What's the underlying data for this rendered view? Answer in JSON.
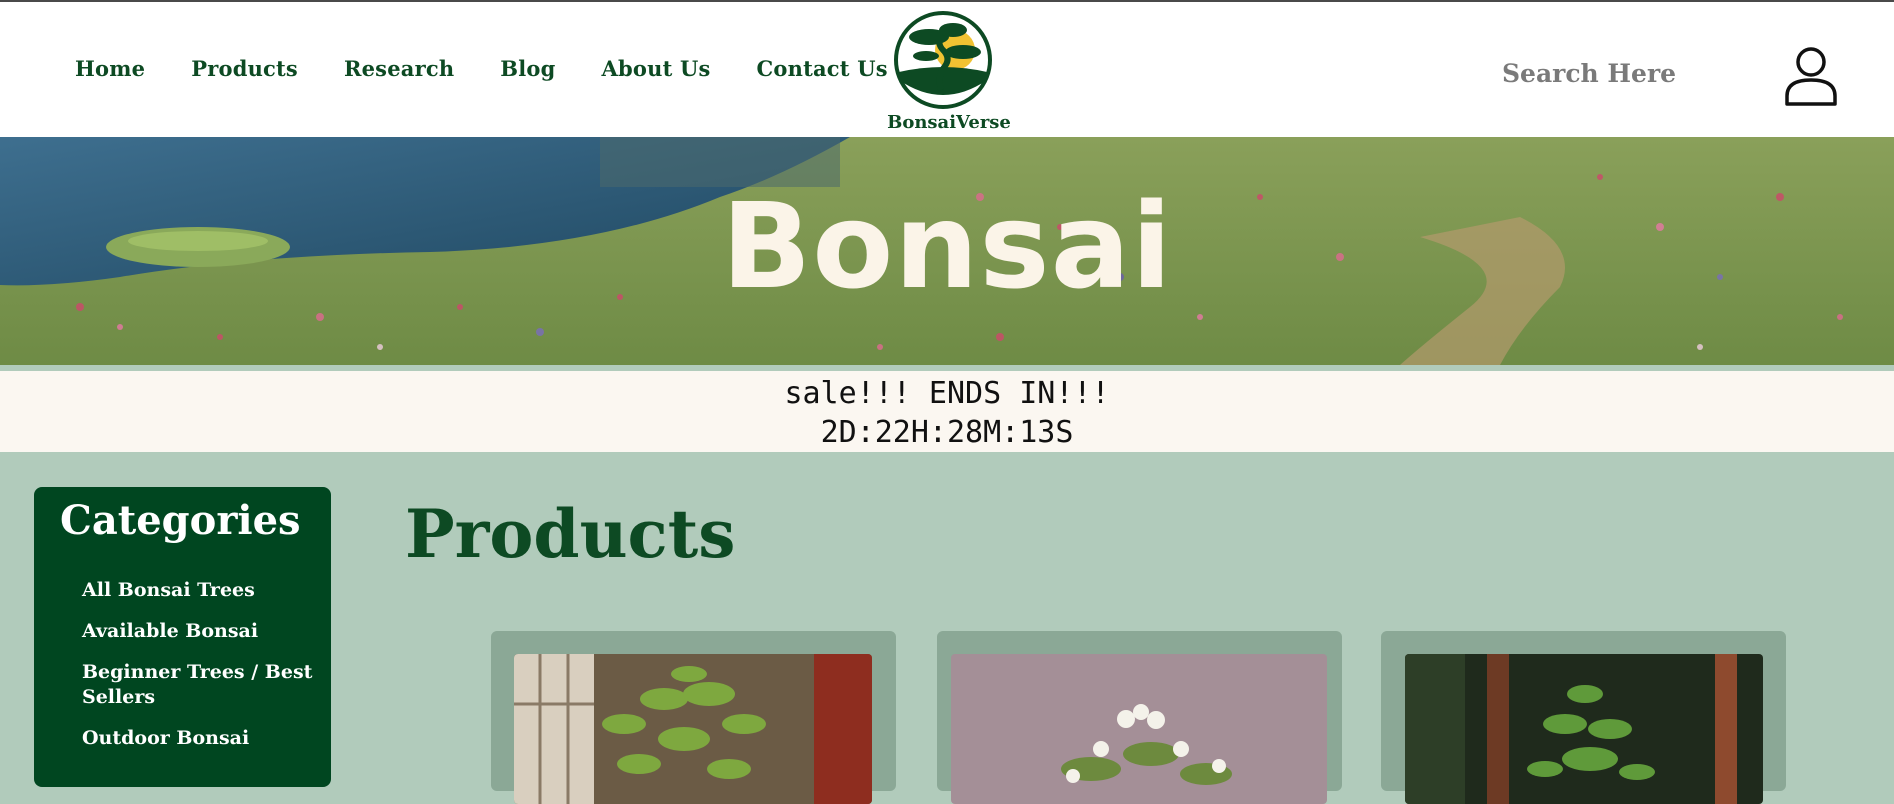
{
  "nav": {
    "items": [
      "Home",
      "Products",
      "Research",
      "Blog",
      "About Us",
      "Contact Us"
    ]
  },
  "brand": {
    "name": "BonsaiVerse"
  },
  "search": {
    "placeholder": "Search Here"
  },
  "icons": {
    "logo": "bonsai-tree-logo-icon",
    "user": "user-icon"
  },
  "hero": {
    "title": "Bonsai"
  },
  "sale": {
    "line1": "sale!!! ENDS IN!!!",
    "line2": "2D:22H:28M:13S"
  },
  "sidebar": {
    "title": "Categories",
    "items": [
      "All Bonsai Trees",
      "Available Bonsai",
      "Beginner Trees / Best Sellers",
      "Outdoor Bonsai"
    ]
  },
  "products": {
    "title": "Products",
    "cards": [
      {
        "image": "ficus-bonsai-photo"
      },
      {
        "image": "honeysuckle-bonsai-photo"
      },
      {
        "image": "outdoor-bonsai-photo"
      }
    ]
  },
  "colors": {
    "primary": "#004620",
    "text_green": "#0d4a23",
    "page_bg": "#b1cbbb",
    "card_bg": "#8ba896",
    "sale_bg": "#fbf7f1",
    "hero_title": "#fbf4e8"
  }
}
